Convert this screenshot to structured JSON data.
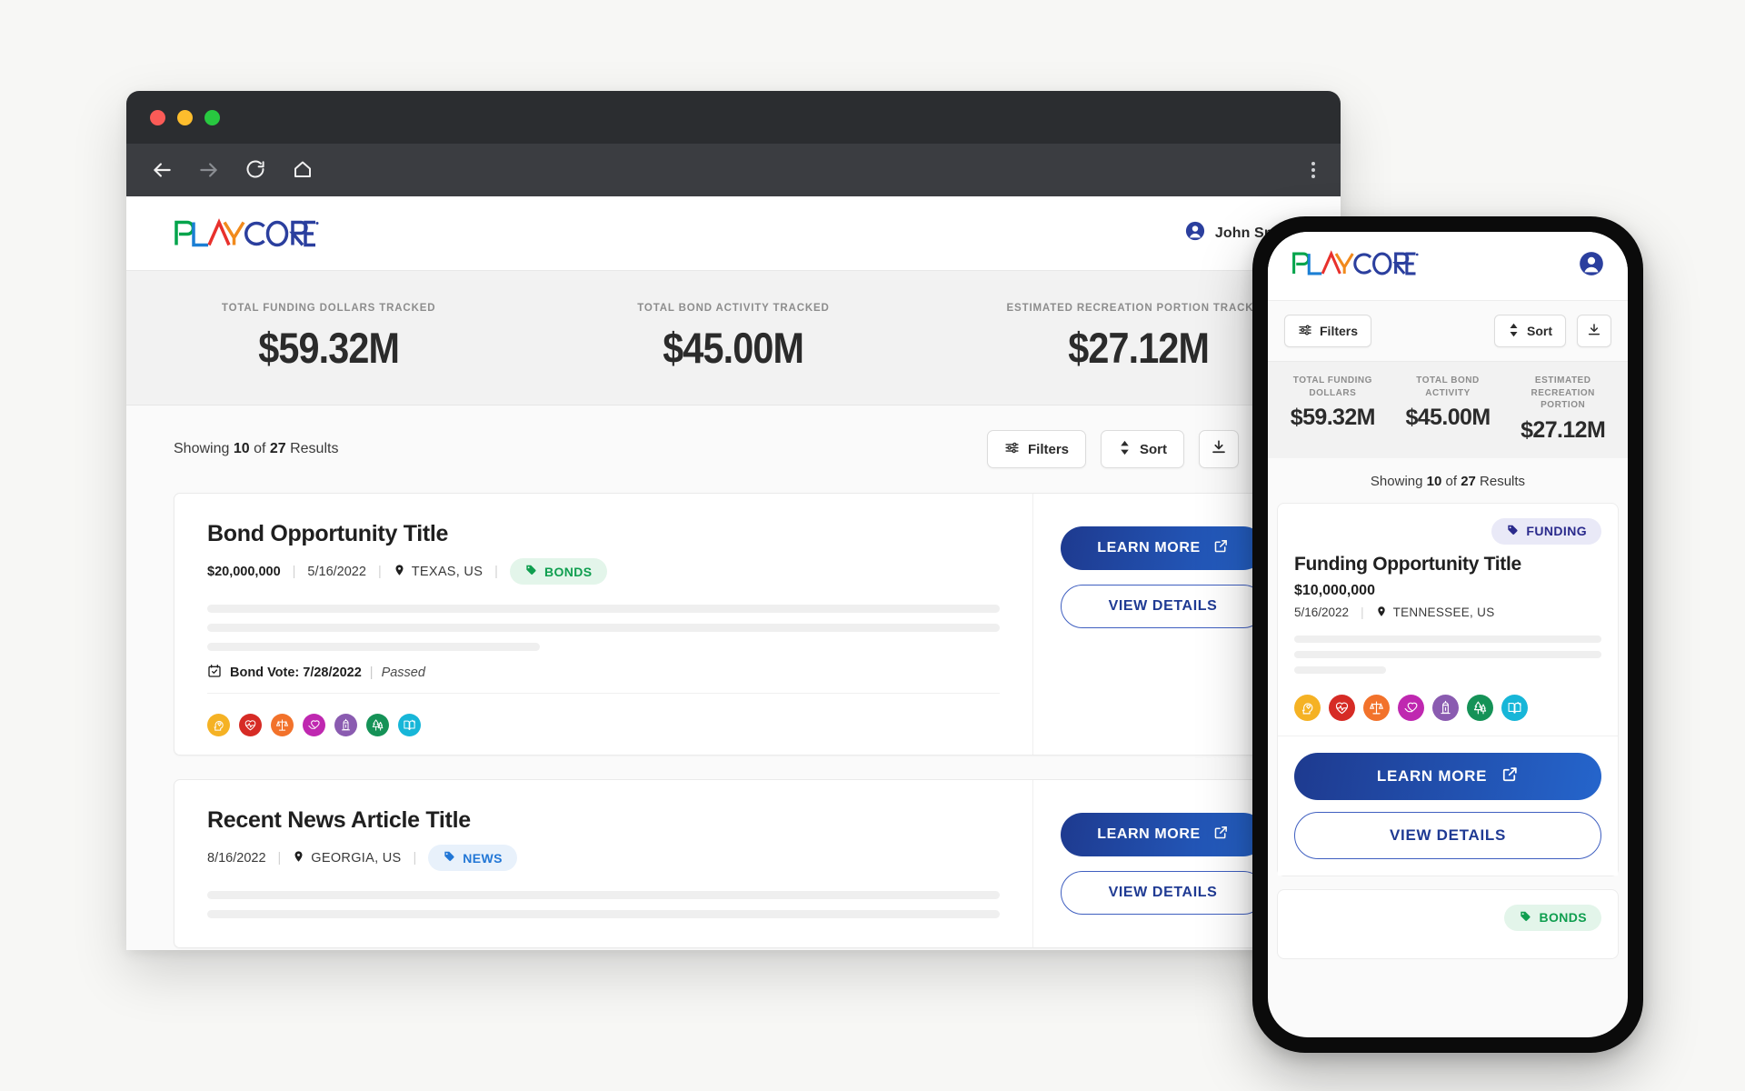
{
  "browser": {
    "nav": {
      "back": "back-arrow",
      "forward": "forward-arrow",
      "reload": "reload-icon",
      "home": "home-icon",
      "menu": "kebab-menu-icon"
    }
  },
  "desktop": {
    "header": {
      "logo_text": "PLAYCORE",
      "user_name": "John Smith"
    },
    "stats": [
      {
        "label": "TOTAL FUNDING DOLLARS TRACKED",
        "value": "$59.32M"
      },
      {
        "label": "TOTAL BOND ACTIVITY TRACKED",
        "value": "$45.00M"
      },
      {
        "label": "ESTIMATED RECREATION PORTION TRACKED",
        "value": "$27.12M"
      }
    ],
    "results": {
      "showing_prefix": "Showing ",
      "showing_count": "10",
      "showing_mid": " of ",
      "showing_total": "27",
      "showing_suffix": " Results"
    },
    "toolbar": {
      "filters_label": "Filters",
      "sort_label": "Sort",
      "download_label": "",
      "extra_label": ""
    },
    "cards": [
      {
        "title": "Bond Opportunity Title",
        "amount": "$20,000,000",
        "date": "5/16/2022",
        "location": "TEXAS, US",
        "tag": "BONDS",
        "tag_type": "bonds",
        "vote_label": "Bond Vote: 7/28/2022",
        "vote_sep": "|",
        "vote_status": "Passed",
        "learn_more": "LEARN MORE",
        "view_details": "VIEW DETAILS"
      },
      {
        "title": "Recent News Article Title",
        "amount": "",
        "date": "8/16/2022",
        "location": "GEORGIA, US",
        "tag": "NEWS",
        "tag_type": "news",
        "learn_more": "LEARN MORE",
        "view_details": "VIEW DETAILS"
      }
    ]
  },
  "mobile": {
    "header": {
      "logo_text": "PLAYCORE"
    },
    "toolbar": {
      "filters_label": "Filters",
      "sort_label": "Sort"
    },
    "stats": [
      {
        "label": "TOTAL FUNDING DOLLARS",
        "value": "$59.32M"
      },
      {
        "label": "TOTAL BOND ACTIVITY",
        "value": "$45.00M"
      },
      {
        "label": "ESTIMATED RECREATION PORTION",
        "value": "$27.12M"
      }
    ],
    "results": {
      "showing_prefix": "Showing ",
      "showing_count": "10",
      "showing_mid": " of ",
      "showing_total": "27",
      "showing_suffix": " Results"
    },
    "card": {
      "tag": "FUNDING",
      "title": "Funding Opportunity Title",
      "amount": "$10,000,000",
      "date": "5/16/2022",
      "location": "TENNESSEE, US",
      "learn_more": "LEARN MORE",
      "view_details": "VIEW DETAILS"
    },
    "next_card": {
      "tag": "BONDS"
    }
  },
  "category_icons": [
    {
      "name": "mind-wellness-icon",
      "color": "#f5b224"
    },
    {
      "name": "heart-health-icon",
      "color": "#d62b25"
    },
    {
      "name": "scales-justice-icon",
      "color": "#f2722b"
    },
    {
      "name": "hand-heart-icon",
      "color": "#bf28b0"
    },
    {
      "name": "civic-building-icon",
      "color": "#8a5bb0"
    },
    {
      "name": "trees-nature-icon",
      "color": "#159257"
    },
    {
      "name": "book-education-icon",
      "color": "#17b6d8"
    }
  ],
  "colors": {
    "brand_navy": "#1f3a93",
    "gradient_start": "#1e3a8f",
    "gradient_end": "#2563c9",
    "bonds_green": "#0f9e4f",
    "news_blue": "#2277d6",
    "funding_navy": "#2a2a8c",
    "titlebar": "#2b2d30",
    "toolbar": "#3b3d41"
  }
}
